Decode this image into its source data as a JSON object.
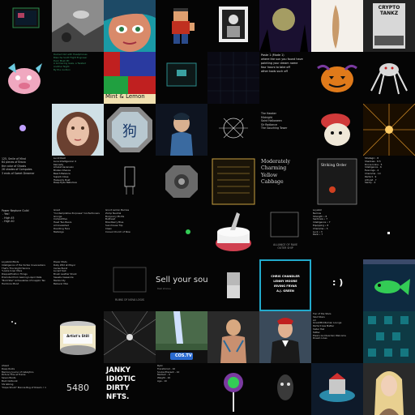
{
  "texts": {
    "t_r1c1_lines": "Decked Out with Headphones\nBlanche Scott Flight Engineer\nPunk Mosh Pit\nA Grimacing Gaze, a Twisted\nAnother Night\nBy the cushion",
    "t_r1c4_lines": "",
    "t_r1c5_lines": "Paste 1 (Mode 1)\nwhere the sun you found have\npainting your dream name\nfour hours to take off\nother tools such off",
    "t_r2c6_lines": "The Hawker\nMidnight\nSaint Halloween\nSir Radiance\nThe Gouching Tower",
    "t_r2c0_lines": "",
    "t_r3c0_lines": "125, Smile of Mind\n64 pieces of Bravo\nthe color of Ghosts\n26 shades of Compotes\n3 ends of Sweet Dreamer",
    "t_r3c1_lines": "Lucid Dust\nLuna Intelligencer 4\nKennedy\nAmulet Ascension\nBroken Chance\nBeach Balance\nSuperb Close\nHeavenly Dust\nDeep Eyes Nebulous",
    "t_r3c5_title": "Moderately\nCharming\nYellow\nCabbage",
    "t_r3c6_label": "Striking Order",
    "t_r3c7_lines": "Strategic . 8\nShadows . 8.5\nDrone Inline . 5\nIntelligence . 6\nEvenings . 4\nCharisma . 10\nPerfect . 9\nAltruist . 7\nSanity . 4",
    "t_r4c0_lines": "Power Neptune Guild\n - Yes!\n - High 45\n - High 40",
    "t_r4c1_lines": "Great\n\"Contemplative Purposes\" Confectioners\nGrunge\nCompetitive\nHead Two Bears\nAll Unwashed\nDaunting Face\nMalbolge",
    "t_r4c2_lines": "Grunt Lemon Berries\nZomp Neutral\nBuoyancy Mortis\nBullhead\nBloodberry Blue\nSunnhouse Trip\nClean\nConsul Church of Now",
    "t_r4c5_label": "ALLIANCE OF RAVE\nOUTER SHIP",
    "t_r4c7_lines": "Loyalist\nNarrow\nStrength • 8\nSentinels • 7\nIntelligence • 7\nEquipping • 8\nCharisma • 5\nLuck • 3\nRank • 7",
    "t_r5c0_lines": "Loyalistic/Mods\nIntelligence of the Vortex Covenanters\nThat's Thornlight Heroics\n\"Looks Inner More\nDisqualification Things\nPromoted from Gaining Liquid Data\n\"Bold Star\" Achievables of Inapplic Tan\nHardcore Mood",
    "t_r5c1_lines": "Power Mods\nRuby Wild at Mayor\nCerise Burst\nLucent Sail\nBrush Leather Shark\nSweets Casserole\nMediocrity\nBeliever Max",
    "t_r5c2_label": "RUINS OF NOVA LOGIS",
    "t_r5c3_sell": "Sell your sou",
    "t_r5c3_sub": "Real share ▸",
    "t_r5c5_names": "CHRIS CHANDLER\nLENNY MOORE\nIRVING FRYAR\nA.J. GREEN",
    "t_r5c6_face": ": )",
    "t_r6c0_lines": "",
    "t_r6c1_label": "Artist's Still",
    "t_r6c3_label": "COS.TV",
    "t_r6c6_lines": "Tier of the Stars\nSkull Stars\nAll\nGreat/Middleman Lounge\nPerfect Gas Matter\nSister Hail\nTattler\nElsie's Go Disorder/ Welcome\nDream Lines",
    "t_r7c0_lines": "Ahead\nDeep Roots\nMemory Journo of Catalytics\nPicture This at Frame\nSeven Boots\nBoot Outburst\nShrubbing\n\"Dope Shoot\" Bonnie Bog of Dream ♪ 1",
    "t_r7c1_number": "5480",
    "t_r7c2_title": "JANKY\nIDIOTIC\nDIRTY\nNFTS.",
    "t_r7c3_lines": "Ryan\nTransferred - 10\nScuba Pharaoh - 10\nMedium - 9\nWeight - 10\nAge - 10",
    "t_r0c7_label": "CRYPTO\nTANKZ",
    "t_r1c2_label": "Mint & Lemon"
  },
  "colors": {
    "accent_cyan": "#22aacc",
    "accent_orange": "#e88a1a",
    "accent_red": "#d03030",
    "accent_green": "#33cc55"
  }
}
